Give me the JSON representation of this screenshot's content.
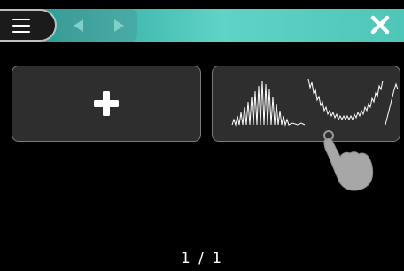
{
  "header": {
    "menu_icon": "hamburger-menu-icon",
    "prev_icon": "left-triangle-icon",
    "next_icon": "right-triangle-icon",
    "close_icon": "close-x-icon",
    "colors": {
      "bar_start": "#1f8e86",
      "bar_end": "#5fd3c6"
    }
  },
  "tiles": [
    {
      "name": "add-tile",
      "icon": "plus-icon"
    },
    {
      "name": "pattern-tile",
      "icon": "stitch-pattern-icon"
    }
  ],
  "pointer": {
    "icon": "pointing-hand-icon"
  },
  "pagination": {
    "text": "1 / 1"
  }
}
